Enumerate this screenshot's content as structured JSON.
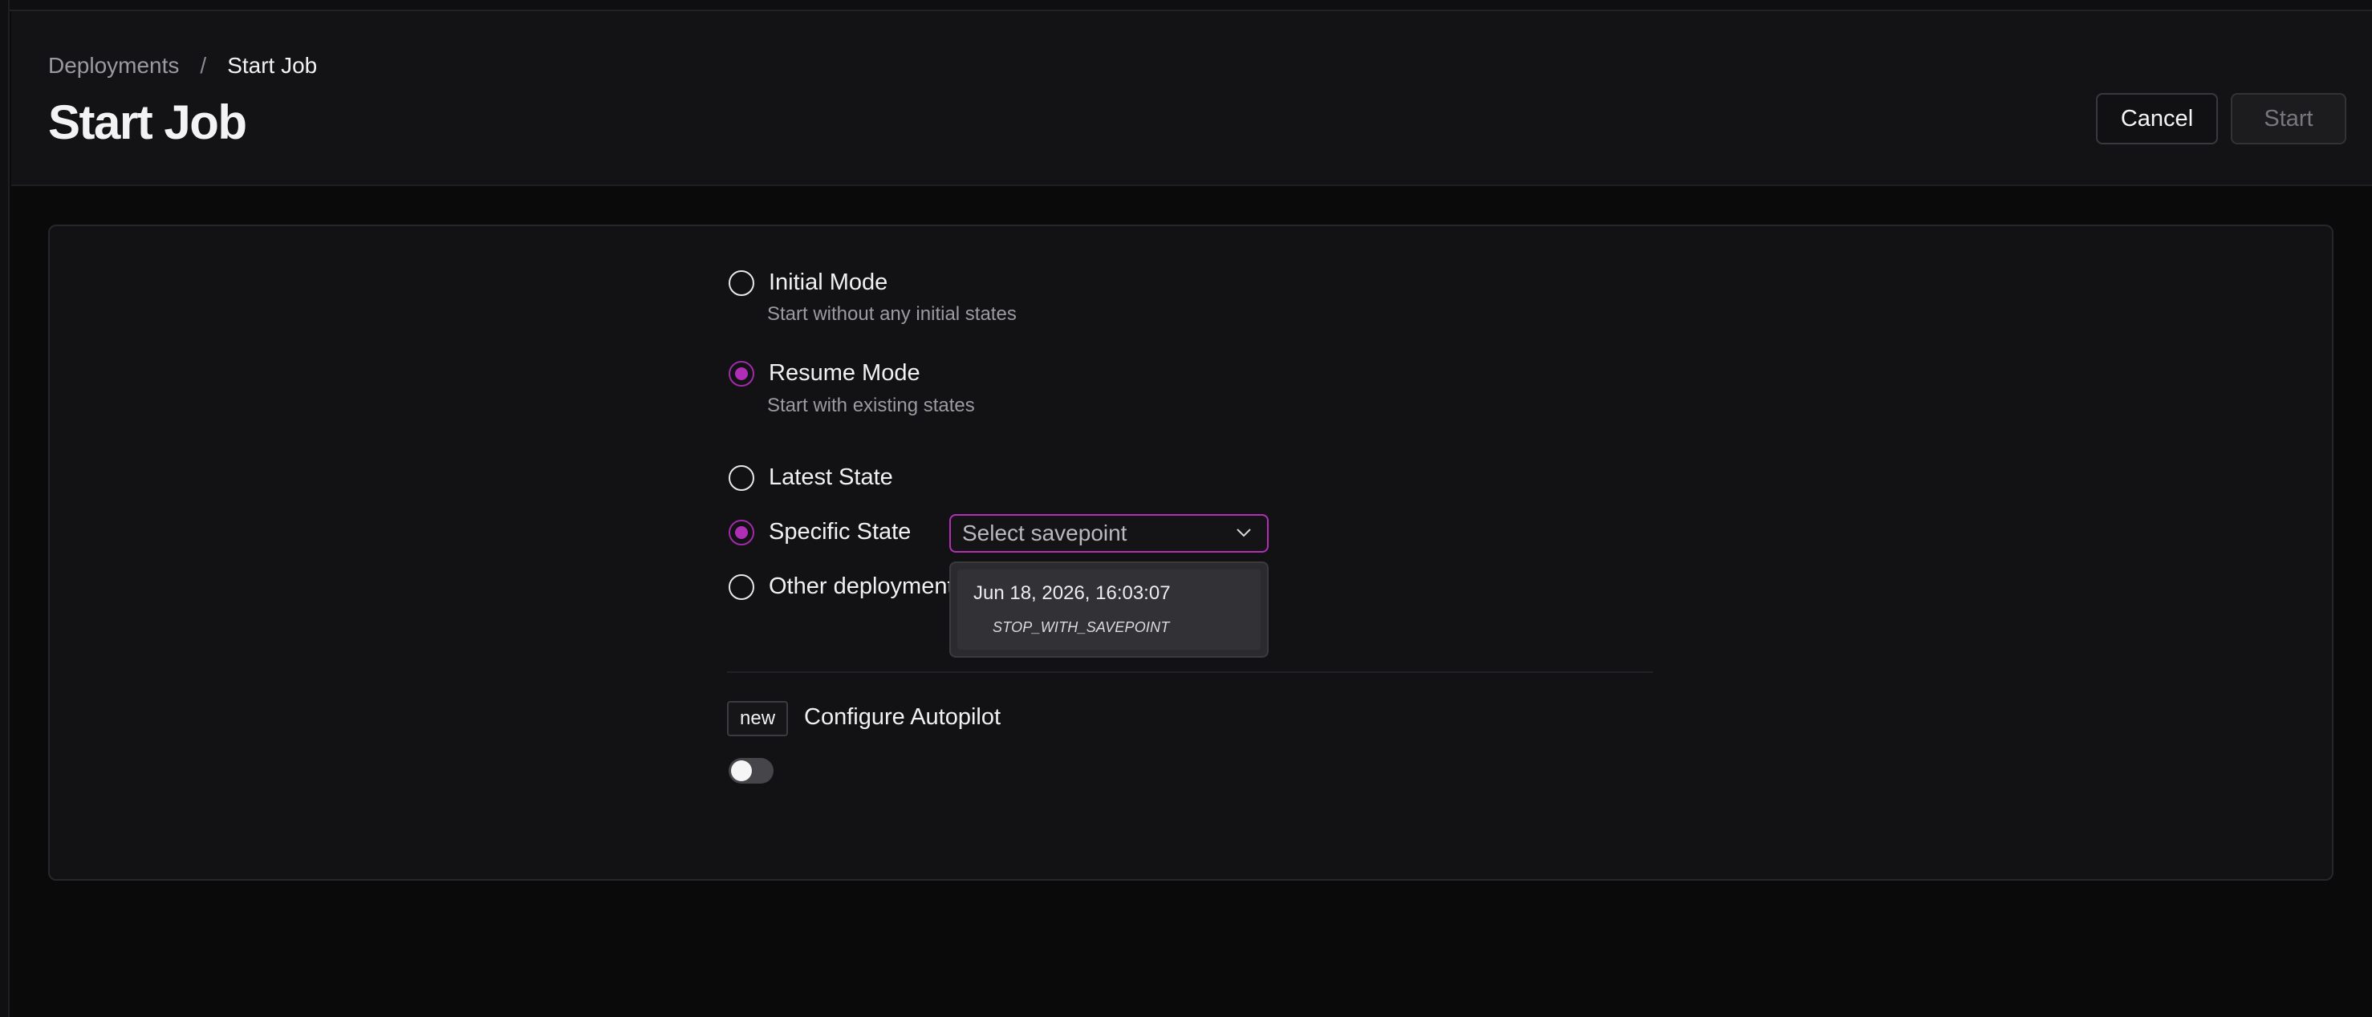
{
  "breadcrumb": {
    "parent": "Deployments",
    "separator": "/",
    "current": "Start Job"
  },
  "page_title": "Start Job",
  "actions": {
    "cancel": "Cancel",
    "start": "Start"
  },
  "start_modes": [
    {
      "label": "Initial Mode",
      "description": "Start without any initial states",
      "selected": false
    },
    {
      "label": "Resume Mode",
      "description": "Start with existing states",
      "selected": true
    }
  ],
  "state_options": [
    {
      "label": "Latest State",
      "selected": false
    },
    {
      "label": "Specific State",
      "selected": true
    },
    {
      "label": "Other deployment",
      "selected": false
    }
  ],
  "savepoint_select": {
    "placeholder": "Select savepoint",
    "options": [
      {
        "date": "Jun 18, 2026, 16:03:07",
        "type": "STOP_WITH_SAVEPOINT"
      }
    ]
  },
  "autopilot": {
    "badge": "new",
    "label": "Configure Autopilot",
    "enabled": false
  },
  "colors": {
    "accent": "#b02db6",
    "background": "#0a0a0a",
    "panel": "#121215"
  },
  "icons": {
    "select_chevron": "chevron-down-icon"
  }
}
